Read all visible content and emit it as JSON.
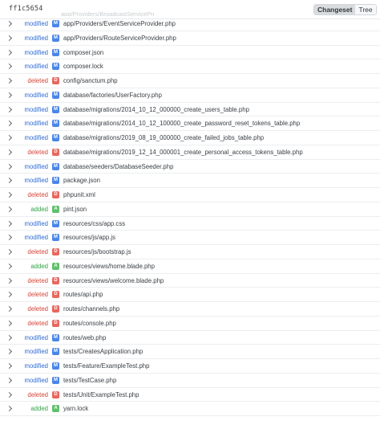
{
  "header": {
    "commit_hash": "ff1c5654",
    "partial_path": "app/Providers/BroadcastServiceProvider.php",
    "tabs": [
      {
        "label": "Changeset",
        "active": true
      },
      {
        "label": "Tree",
        "active": false
      }
    ]
  },
  "colors": {
    "modified": "#2f6bd3",
    "deleted": "#d6453b",
    "added": "#32a447"
  },
  "files": [
    {
      "status": "modified",
      "badge": "M",
      "path": "app/Providers/EventServiceProvider.php"
    },
    {
      "status": "modified",
      "badge": "M",
      "path": "app/Providers/RouteServiceProvider.php"
    },
    {
      "status": "modified",
      "badge": "M",
      "path": "composer.json"
    },
    {
      "status": "modified",
      "badge": "M",
      "path": "composer.lock"
    },
    {
      "status": "deleted",
      "badge": "D",
      "path": "config/sanctum.php"
    },
    {
      "status": "modified",
      "badge": "M",
      "path": "database/factories/UserFactory.php"
    },
    {
      "status": "modified",
      "badge": "M",
      "path": "database/migrations/2014_10_12_000000_create_users_table.php"
    },
    {
      "status": "modified",
      "badge": "M",
      "path": "database/migrations/2014_10_12_100000_create_password_reset_tokens_table.php"
    },
    {
      "status": "modified",
      "badge": "M",
      "path": "database/migrations/2019_08_19_000000_create_failed_jobs_table.php"
    },
    {
      "status": "deleted",
      "badge": "D",
      "path": "database/migrations/2019_12_14_000001_create_personal_access_tokens_table.php"
    },
    {
      "status": "modified",
      "badge": "M",
      "path": "database/seeders/DatabaseSeeder.php"
    },
    {
      "status": "modified",
      "badge": "M",
      "path": "package.json"
    },
    {
      "status": "deleted",
      "badge": "D",
      "path": "phpunit.xml"
    },
    {
      "status": "added",
      "badge": "A",
      "path": "pint.json"
    },
    {
      "status": "modified",
      "badge": "M",
      "path": "resources/css/app.css"
    },
    {
      "status": "modified",
      "badge": "M",
      "path": "resources/js/app.js"
    },
    {
      "status": "deleted",
      "badge": "D",
      "path": "resources/js/bootstrap.js"
    },
    {
      "status": "added",
      "badge": "A",
      "path": "resources/views/home.blade.php"
    },
    {
      "status": "deleted",
      "badge": "D",
      "path": "resources/views/welcome.blade.php"
    },
    {
      "status": "deleted",
      "badge": "D",
      "path": "routes/api.php"
    },
    {
      "status": "deleted",
      "badge": "D",
      "path": "routes/channels.php"
    },
    {
      "status": "deleted",
      "badge": "D",
      "path": "routes/console.php"
    },
    {
      "status": "modified",
      "badge": "M",
      "path": "routes/web.php"
    },
    {
      "status": "modified",
      "badge": "M",
      "path": "tests/CreatesApplication.php"
    },
    {
      "status": "modified",
      "badge": "M",
      "path": "tests/Feature/ExampleTest.php"
    },
    {
      "status": "modified",
      "badge": "M",
      "path": "tests/TestCase.php"
    },
    {
      "status": "deleted",
      "badge": "D",
      "path": "tests/Unit/ExampleTest.php"
    },
    {
      "status": "added",
      "badge": "A",
      "path": "yarn.lock"
    }
  ]
}
